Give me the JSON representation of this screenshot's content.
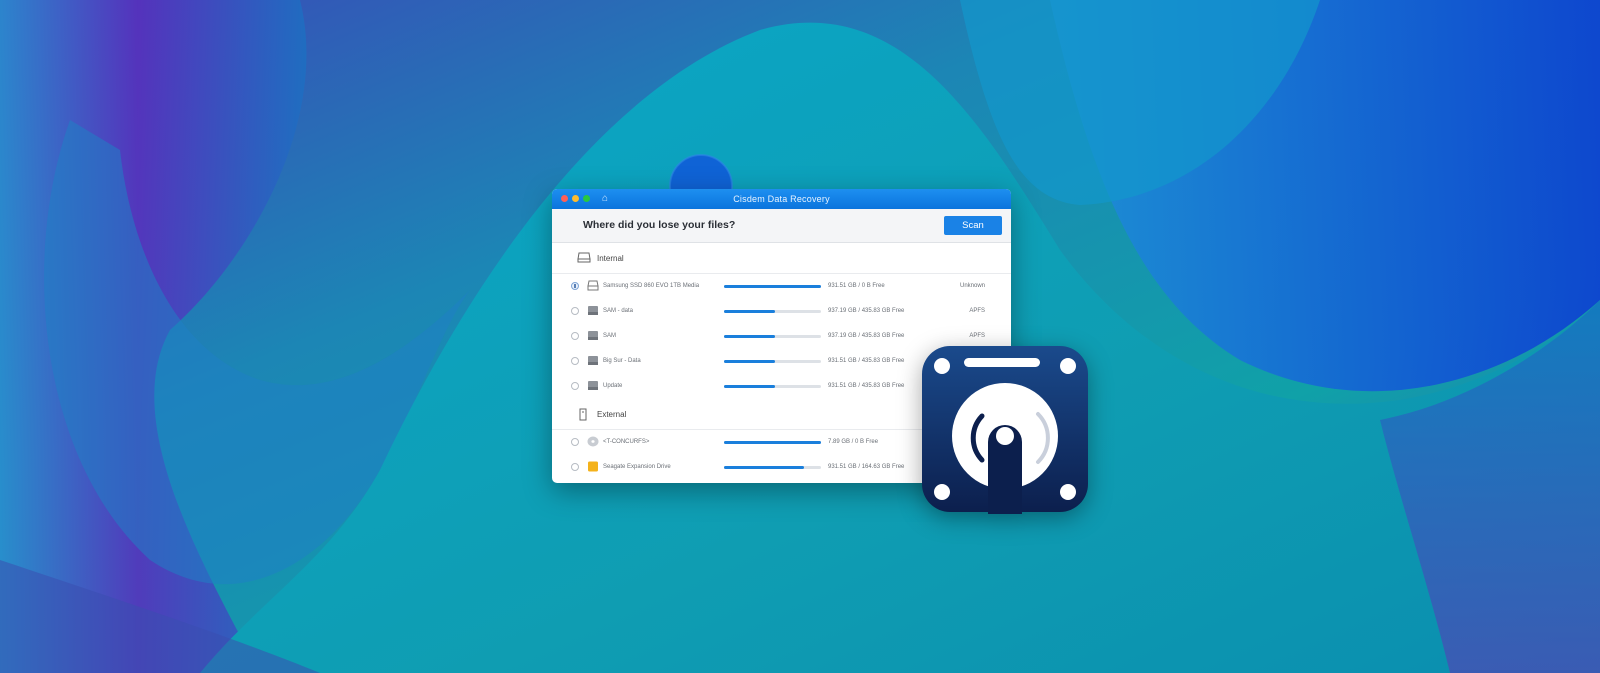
{
  "window": {
    "title": "Cisdem Data Recovery",
    "question": "Where did you lose your files?",
    "scan_label": "Scan"
  },
  "sections": {
    "internal": {
      "label": "Internal",
      "drives": [
        {
          "name": "Samsung SSD 860 EVO 1TB Media",
          "size": "931.51 GB / 0 B Free",
          "fs": "Unknown",
          "usage": 1.0,
          "selected": true,
          "icon": "hard-drive-icon"
        },
        {
          "name": "SAM - data",
          "size": "937.19 GB / 435.83 GB Free",
          "fs": "APFS",
          "usage": 0.53,
          "selected": false,
          "icon": "volume-icon"
        },
        {
          "name": "SAM",
          "size": "937.19 GB / 435.83 GB Free",
          "fs": "APFS",
          "usage": 0.53,
          "selected": false,
          "icon": "volume-icon"
        },
        {
          "name": "Big Sur - Data",
          "size": "931.51 GB / 435.83 GB Free",
          "fs": "",
          "usage": 0.53,
          "selected": false,
          "icon": "volume-icon"
        },
        {
          "name": "Update",
          "size": "931.51 GB / 435.83 GB Free",
          "fs": "",
          "usage": 0.53,
          "selected": false,
          "icon": "volume-icon"
        }
      ]
    },
    "external": {
      "label": "External",
      "drives": [
        {
          "name": "<T-CONCURFS>",
          "size": "7.89 GB / 0 B Free",
          "fs": "",
          "usage": 1.0,
          "selected": false,
          "icon": "disc-icon"
        },
        {
          "name": "Seagate Expansion Drive",
          "size": "931.51 GB / 164.63 GB Free",
          "fs": "",
          "usage": 0.82,
          "selected": false,
          "icon": "external-drive-icon"
        }
      ]
    }
  },
  "colors": {
    "accent": "#1a82e6",
    "titlebar": "#0b74dd",
    "app_icon_bg": "#0f2d63"
  }
}
